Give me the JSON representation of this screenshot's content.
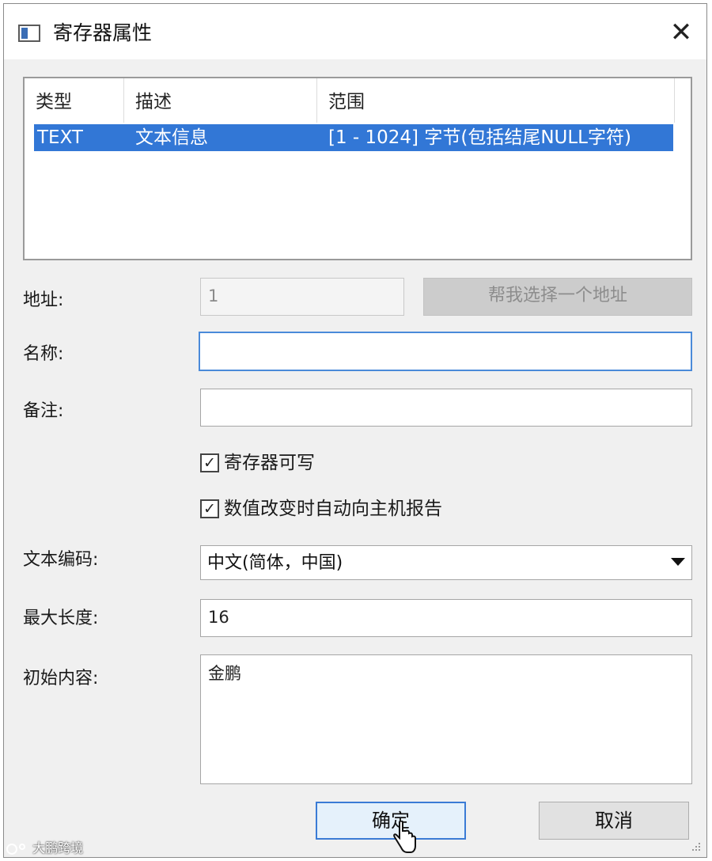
{
  "window": {
    "title": "寄存器属性",
    "close_glyph": "✕",
    "icon": "window-app-icon"
  },
  "table": {
    "columns": [
      "类型",
      "描述",
      "范围"
    ],
    "rows": [
      {
        "type": "TEXT",
        "description": "文本信息",
        "range": "[1 - 1024] 字节(包括结尾NULL字符)",
        "selected": true
      }
    ],
    "selection_color": "#3277d6"
  },
  "form": {
    "address": {
      "label": "地址:",
      "value": "1",
      "disabled": true
    },
    "pick_address_button": {
      "label": "帮我选择一个地址",
      "disabled": true
    },
    "name": {
      "label": "名称:",
      "value": ""
    },
    "remark": {
      "label": "备注:",
      "value": ""
    },
    "writable": {
      "label": "寄存器可写",
      "checked": true
    },
    "auto_report": {
      "label": "数值改变时自动向主机报告",
      "checked": true
    },
    "encoding": {
      "label": "文本编码:",
      "value": "中文(简体，中国)"
    },
    "max_length": {
      "label": "最大长度:",
      "value": "16"
    },
    "initial_content": {
      "label": "初始内容:",
      "value": "金鹏"
    }
  },
  "buttons": {
    "ok": "确定",
    "cancel": "取消"
  },
  "checkmark": "✓",
  "watermark": {
    "text": "大鹏跨境",
    "logo_icon": "watermark-logo-icon"
  }
}
